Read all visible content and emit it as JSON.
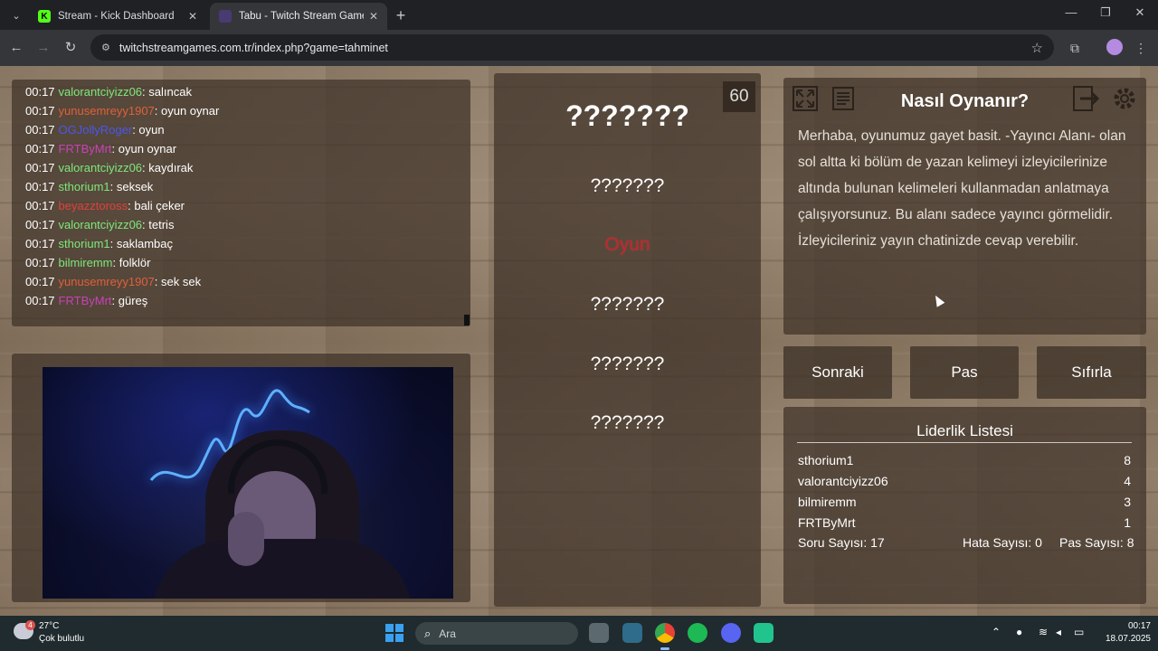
{
  "browser": {
    "tabs": [
      {
        "title": "Stream - Kick Dashboard",
        "favicon": "K",
        "favicon_color": "#53fc18",
        "active": false
      },
      {
        "title": "Tabu - Twitch Stream Games",
        "favicon": "",
        "favicon_color": "#6441a5",
        "active": true
      }
    ],
    "url": "twitchstreamgames.com.tr/index.php?game=tahminet"
  },
  "chat": {
    "messages": [
      {
        "time": "00:17",
        "user": "valorantciyizz06",
        "color": "#7ee87a",
        "text": ": salıncak"
      },
      {
        "time": "00:17",
        "user": "yunusemreyy1907",
        "color": "#e0603a",
        "text": ": oyun oynar"
      },
      {
        "time": "00:17",
        "user": "OGJollyRoger",
        "color": "#4b57e8",
        "text": ": oyun"
      },
      {
        "time": "00:17",
        "user": "FRTByMrt",
        "color": "#c842b5",
        "text": ": oyun oynar"
      },
      {
        "time": "00:17",
        "user": "valorantciyizz06",
        "color": "#7ee87a",
        "text": ": kaydırak"
      },
      {
        "time": "00:17",
        "user": "sthorium1",
        "color": "#7ee87a",
        "text": ": seksek"
      },
      {
        "time": "00:17",
        "user": "beyazztoross",
        "color": "#e0403a",
        "text": ": bali çeker"
      },
      {
        "time": "00:17",
        "user": "valorantciyizz06",
        "color": "#7ee87a",
        "text": ": tetris"
      },
      {
        "time": "00:17",
        "user": "sthorium1",
        "color": "#7ee87a",
        "text": ": saklambaç"
      },
      {
        "time": "00:17",
        "user": "bilmiremm",
        "color": "#7ee87a",
        "text": ": folklör"
      },
      {
        "time": "00:17",
        "user": "yunusemreyy1907",
        "color": "#e0603a",
        "text": ": sek sek"
      },
      {
        "time": "00:17",
        "user": "FRTByMrt",
        "color": "#c842b5",
        "text": ": güreş"
      }
    ]
  },
  "card": {
    "timer": "60",
    "main_word": "???????",
    "taboo_words": [
      "???????",
      "Oyun",
      "???????",
      "???????",
      "???????"
    ],
    "highlight_color": "#c0282e"
  },
  "howto": {
    "title": "Nasıl Oynanır?",
    "text": "Merhaba, oyunumuz gayet basit. -Yayıncı Alanı- olan sol altta ki bölüm de yazan kelimeyi izleyicilerinize altında bulunan kelimeleri kullanmadan anlatmaya çalışıyorsunuz. Bu alanı sadece yayıncı görmelidir. İzleyicileriniz yayın chatinizde cevap verebilir.",
    "icons": [
      "fullscreen-icon",
      "document-icon",
      "exit-icon",
      "settings-icon"
    ]
  },
  "buttons": {
    "next": "Sonraki",
    "pass": "Pas",
    "reset": "Sıfırla"
  },
  "leaderboard": {
    "title": "Liderlik Listesi",
    "rows": [
      {
        "name": "sthorium1",
        "score": "8"
      },
      {
        "name": "valorantciyizz06",
        "score": "4"
      },
      {
        "name": "bilmiremm",
        "score": "3"
      },
      {
        "name": "FRTByMrt",
        "score": "1"
      }
    ],
    "question_count": "Soru Sayısı: 17",
    "error_count": "Hata Sayısı: 0",
    "pass_count": "Pas Sayısı: 8"
  },
  "taskbar": {
    "weather_badge": "4",
    "temperature": "27°C",
    "weather": "Çok bulutlu",
    "search_placeholder": "Ara",
    "time": "00:17",
    "date": "18.07.2025"
  }
}
